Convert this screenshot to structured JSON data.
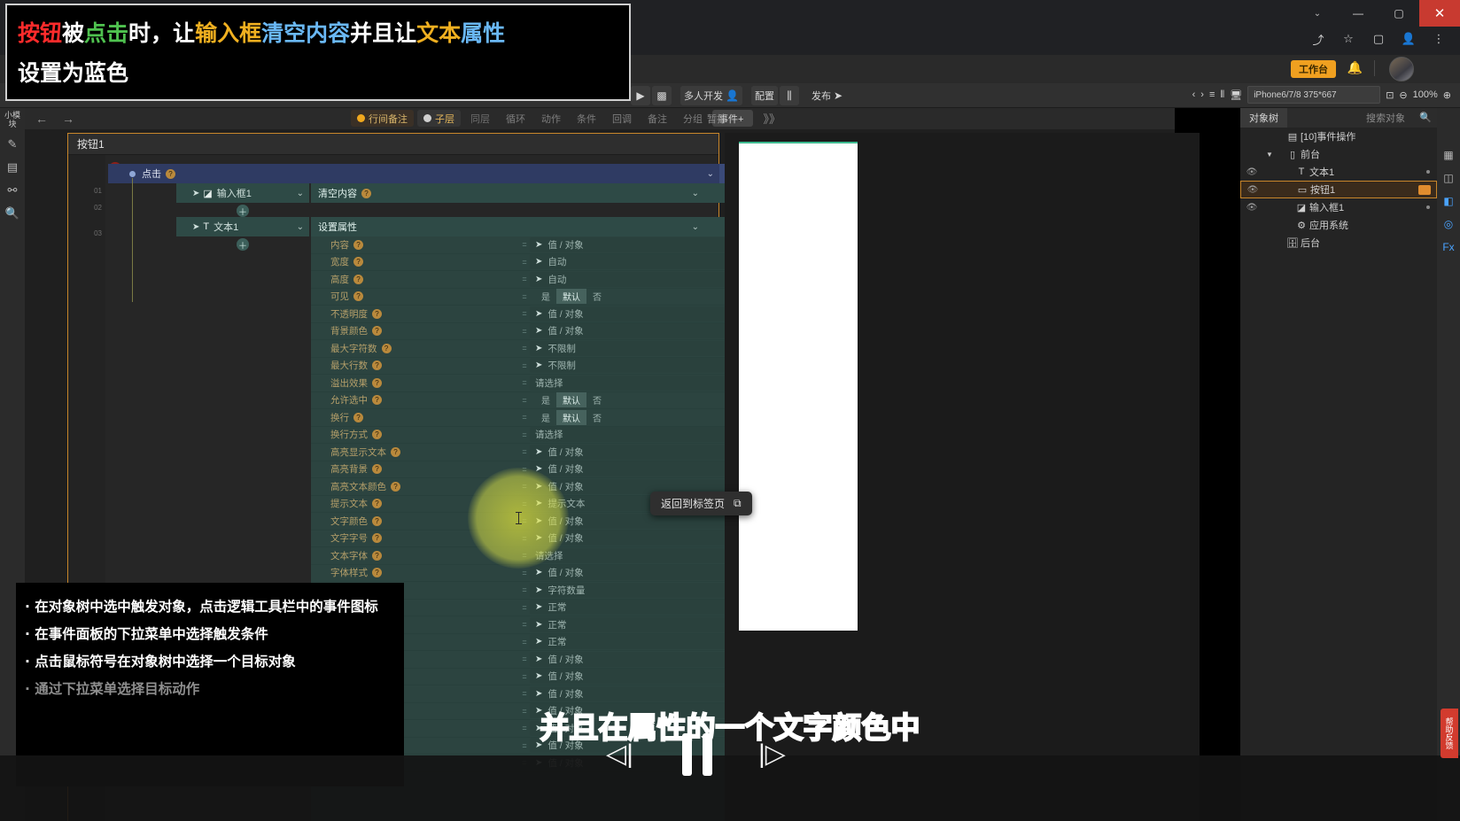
{
  "browser": {
    "window_controls": {
      "chevron": "⌄",
      "minimize": "—",
      "maximize": "▢",
      "close": "✕"
    },
    "omnibox_icons": [
      "share-icon",
      "star-icon",
      "window-icon",
      "profile-icon",
      "menu-icon"
    ]
  },
  "app_top": {
    "workspace_label": "工作台",
    "bell_icon": "bell-icon",
    "avatar": "user-avatar"
  },
  "toolbar": {
    "left_group": [
      {
        "name": "preview-run",
        "icon": "▶",
        "label": ""
      },
      {
        "name": "qrcode",
        "icon": "▩",
        "label": ""
      },
      {
        "name": "multi-dev",
        "icon": "👤",
        "label": "多人开发"
      },
      {
        "name": "config",
        "icon": "▤",
        "label": "配置"
      },
      {
        "name": "settings-sliders",
        "icon": "⫼",
        "label": ""
      },
      {
        "name": "publish",
        "icon": "➤",
        "label": "发布"
      }
    ],
    "right_group": {
      "prev": "‹",
      "next": "›",
      "align": "≡",
      "distribute": "⦀",
      "device_icon": "🖥",
      "device": "iPhone6/7/8 375*667",
      "fit": "⊡",
      "zoom_minus": "⊖",
      "zoom_value": "100%",
      "zoom_plus": "⊕"
    }
  },
  "left_rail": {
    "title": "小模块",
    "items": [
      "pencil-icon",
      "layers-icon",
      "link-icon",
      "search-icon"
    ]
  },
  "right_rail": {
    "items": [
      "grid-icon",
      "component-icon",
      "style-icon",
      "api-icon",
      "fx-icon"
    ]
  },
  "logic_tabs": {
    "back_arrow": "←",
    "forward_arrow": "→",
    "chips": [
      {
        "name": "line-note",
        "label": "行间备注",
        "state": "active",
        "dot": true
      },
      {
        "name": "sub-layer",
        "label": "子层",
        "state": "active",
        "dot": true
      },
      {
        "name": "same-layer",
        "label": "同层",
        "state": "off",
        "dot": false
      },
      {
        "name": "loop",
        "label": "循环",
        "state": "dim",
        "dot": false
      },
      {
        "name": "action",
        "label": "动作",
        "state": "dim",
        "dot": false
      },
      {
        "name": "condition",
        "label": "条件",
        "state": "dim",
        "dot": false
      },
      {
        "name": "callback",
        "label": "回调",
        "state": "dim",
        "dot": false
      },
      {
        "name": "note",
        "label": "备注",
        "state": "dim",
        "dot": false
      },
      {
        "name": "group",
        "label": "分组",
        "state": "dim",
        "dot": false
      },
      {
        "name": "event-add",
        "label": "事件+",
        "state": "event",
        "dot": false
      },
      {
        "name": "more",
        "label": "》》",
        "state": "more",
        "dot": false
      }
    ],
    "collapse_label": "暂折"
  },
  "event_panel": {
    "header": "按钮1",
    "gutter_numbers": [
      "01",
      "02",
      "03"
    ],
    "trigger": {
      "label": "点击",
      "help": "?",
      "caret": "⌄",
      "plus": "+"
    },
    "actions": [
      {
        "object": "输入框1",
        "object_icon": "input-icon",
        "do": "清空内容",
        "has_help": true
      },
      {
        "object": "文本1",
        "object_icon": "text-icon",
        "do": "设置属性",
        "has_help": false
      }
    ],
    "properties": [
      {
        "name": "内容",
        "help": true,
        "value": "值 / 对象",
        "type": "pointer"
      },
      {
        "name": "宽度",
        "help": true,
        "value": "自动",
        "type": "pointer"
      },
      {
        "name": "高度",
        "help": true,
        "value": "自动",
        "type": "pointer"
      },
      {
        "name": "可见",
        "help": true,
        "value": "",
        "type": "segment",
        "segments": [
          "是",
          "默认",
          "否"
        ],
        "selected": "默认"
      },
      {
        "name": "不透明度",
        "help": true,
        "value": "值 / 对象",
        "type": "pointer"
      },
      {
        "name": "背景颜色",
        "help": true,
        "value": "值 / 对象",
        "type": "pointer"
      },
      {
        "name": "最大字符数",
        "help": true,
        "value": "不限制",
        "type": "pointer"
      },
      {
        "name": "最大行数",
        "help": true,
        "value": "不限制",
        "type": "pointer"
      },
      {
        "name": "溢出效果",
        "help": true,
        "value": "请选择",
        "type": "placeholder"
      },
      {
        "name": "允许选中",
        "help": true,
        "value": "",
        "type": "segment",
        "segments": [
          "是",
          "默认",
          "否"
        ],
        "selected": "默认"
      },
      {
        "name": "换行",
        "help": true,
        "value": "",
        "type": "segment",
        "segments": [
          "是",
          "默认",
          "否"
        ],
        "selected": "默认"
      },
      {
        "name": "换行方式",
        "help": true,
        "value": "请选择",
        "type": "placeholder"
      },
      {
        "name": "高亮显示文本",
        "help": true,
        "value": "值 / 对象",
        "type": "pointer"
      },
      {
        "name": "高亮背景",
        "help": true,
        "value": "值 / 对象",
        "type": "pointer"
      },
      {
        "name": "高亮文本颜色",
        "help": true,
        "value": "值 / 对象",
        "type": "pointer"
      },
      {
        "name": "提示文本",
        "help": true,
        "value": "提示文本",
        "type": "pointer"
      },
      {
        "name": "文字颜色",
        "help": true,
        "value": "值 / 对象",
        "type": "pointer"
      },
      {
        "name": "文字字号",
        "help": true,
        "value": "值 / 对象",
        "type": "pointer"
      },
      {
        "name": "文本字体",
        "help": true,
        "value": "请选择",
        "type": "placeholder"
      },
      {
        "name": "字体样式",
        "help": true,
        "value": "值 / 对象",
        "type": "pointer"
      },
      {
        "name": "",
        "help": false,
        "value": "字符数量",
        "type": "pointer"
      },
      {
        "name": "",
        "help": false,
        "value": "正常",
        "type": "pointer"
      },
      {
        "name": "",
        "help": false,
        "value": "正常",
        "type": "pointer"
      },
      {
        "name": "",
        "help": false,
        "value": "正常",
        "type": "pointer"
      },
      {
        "name": "",
        "help": false,
        "value": "值 / 对象",
        "type": "pointer"
      },
      {
        "name": "",
        "help": false,
        "value": "值 / 对象",
        "type": "pointer"
      },
      {
        "name": "",
        "help": false,
        "value": "值 / 对象",
        "type": "pointer"
      },
      {
        "name": "",
        "help": false,
        "value": "值 / 对象",
        "type": "pointer"
      },
      {
        "name": "",
        "help": false,
        "value": "值 / 对象",
        "type": "pointer"
      },
      {
        "name": "",
        "help": false,
        "value": "值 / 对象",
        "type": "pointer"
      },
      {
        "name": "",
        "help": false,
        "value": "值 / 对象",
        "type": "pointer"
      }
    ]
  },
  "preview": {
    "tooltip": "返回到标签页",
    "tooltip_icon": "external-link-icon"
  },
  "object_tree": {
    "tab_active": "对象树",
    "tab_inactive": "搜索对象",
    "search_icon": "search-icon",
    "rows": [
      {
        "label": "[10]事件操作",
        "icon": "event-icon",
        "indent": 1,
        "eye": false,
        "caret": "",
        "selected": false,
        "badge": false
      },
      {
        "label": "前台",
        "icon": "page-icon",
        "indent": 1,
        "eye": false,
        "caret": "▼",
        "selected": false,
        "badge": false
      },
      {
        "label": "文本1",
        "icon": "text-icon",
        "indent": 2,
        "eye": true,
        "caret": "",
        "selected": false,
        "badge": false,
        "dot": true
      },
      {
        "label": "按钮1",
        "icon": "button-icon",
        "indent": 2,
        "eye": true,
        "caret": "",
        "selected": true,
        "badge": true
      },
      {
        "label": "输入框1",
        "icon": "input-icon",
        "indent": 2,
        "eye": true,
        "caret": "",
        "selected": false,
        "badge": false,
        "dot": true
      },
      {
        "label": "应用系统",
        "icon": "gear-icon",
        "indent": 2,
        "eye": false,
        "caret": "",
        "selected": false,
        "badge": false
      },
      {
        "label": "后台",
        "icon": "server-icon",
        "indent": 1,
        "eye": false,
        "caret": "",
        "selected": false,
        "badge": false
      }
    ]
  },
  "overlay": {
    "title_line1_parts": [
      {
        "text": "按钮",
        "color": "#ff2b2b"
      },
      {
        "text": "被",
        "color": "#ffffff"
      },
      {
        "text": "点击",
        "color": "#4fc24f"
      },
      {
        "text": "时，让",
        "color": "#ffffff"
      },
      {
        "text": "输入框",
        "color": "#f0b020"
      },
      {
        "text": "清空内容",
        "color": "#6ab8f5"
      },
      {
        "text": "并且让",
        "color": "#ffffff"
      },
      {
        "text": "文本",
        "color": "#f0b020"
      },
      {
        "text": "属性",
        "color": "#6ab8f5"
      }
    ],
    "title_line2": "设置为蓝色",
    "notes": [
      {
        "text": "· 在对象树中选中触发对象，点击逻辑工具栏中的事件图标",
        "faded": false
      },
      {
        "text": "· 在事件面板的下拉菜单中选择触发条件",
        "faded": false
      },
      {
        "text": "· 点击鼠标符号在对象树中选择一个目标对象",
        "faded": false
      },
      {
        "text": "· 通过下拉菜单选择目标动作",
        "faded": true
      }
    ],
    "subtitle": "并且在属性的一个文字颜色中"
  },
  "player": {
    "prev_icon": "◁|",
    "pause_icon": "❚❚",
    "next_icon": "|▷"
  },
  "side_tab": {
    "label": "帮助反馈"
  },
  "colors": {
    "accent_orange": "#c8862a",
    "panel_green": "#2c4440",
    "trigger_blue": "#2f3b63",
    "prop_label": "#b6a06a"
  }
}
